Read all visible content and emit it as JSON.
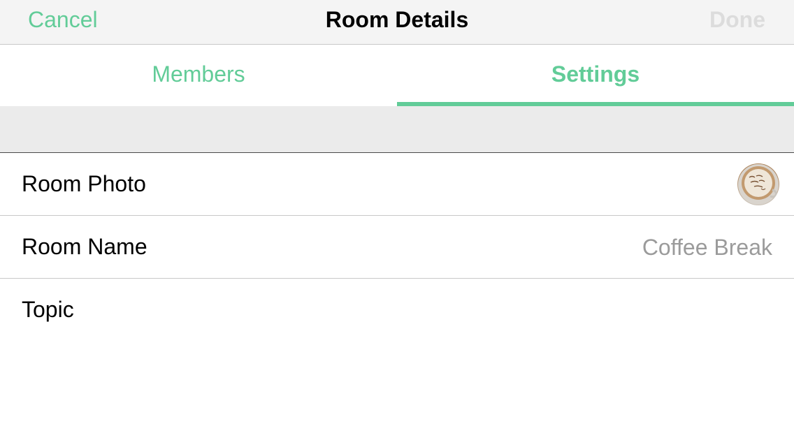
{
  "navbar": {
    "cancel_label": "Cancel",
    "title": "Room Details",
    "done_label": "Done"
  },
  "tabs": [
    {
      "label": "Members",
      "active": false
    },
    {
      "label": "Settings",
      "active": true
    }
  ],
  "settings": {
    "room_photo_label": "Room Photo",
    "room_photo_icon": "room-photo-avatar",
    "room_name_label": "Room Name",
    "room_name_value": "Coffee Break",
    "topic_label": "Topic",
    "topic_value": ""
  },
  "colors": {
    "accent": "#62cc98",
    "done_disabled": "#dcdcdc",
    "value_text": "#9b9b9b",
    "section_background": "#ebebeb",
    "navbar_background": "#f4f4f4"
  }
}
